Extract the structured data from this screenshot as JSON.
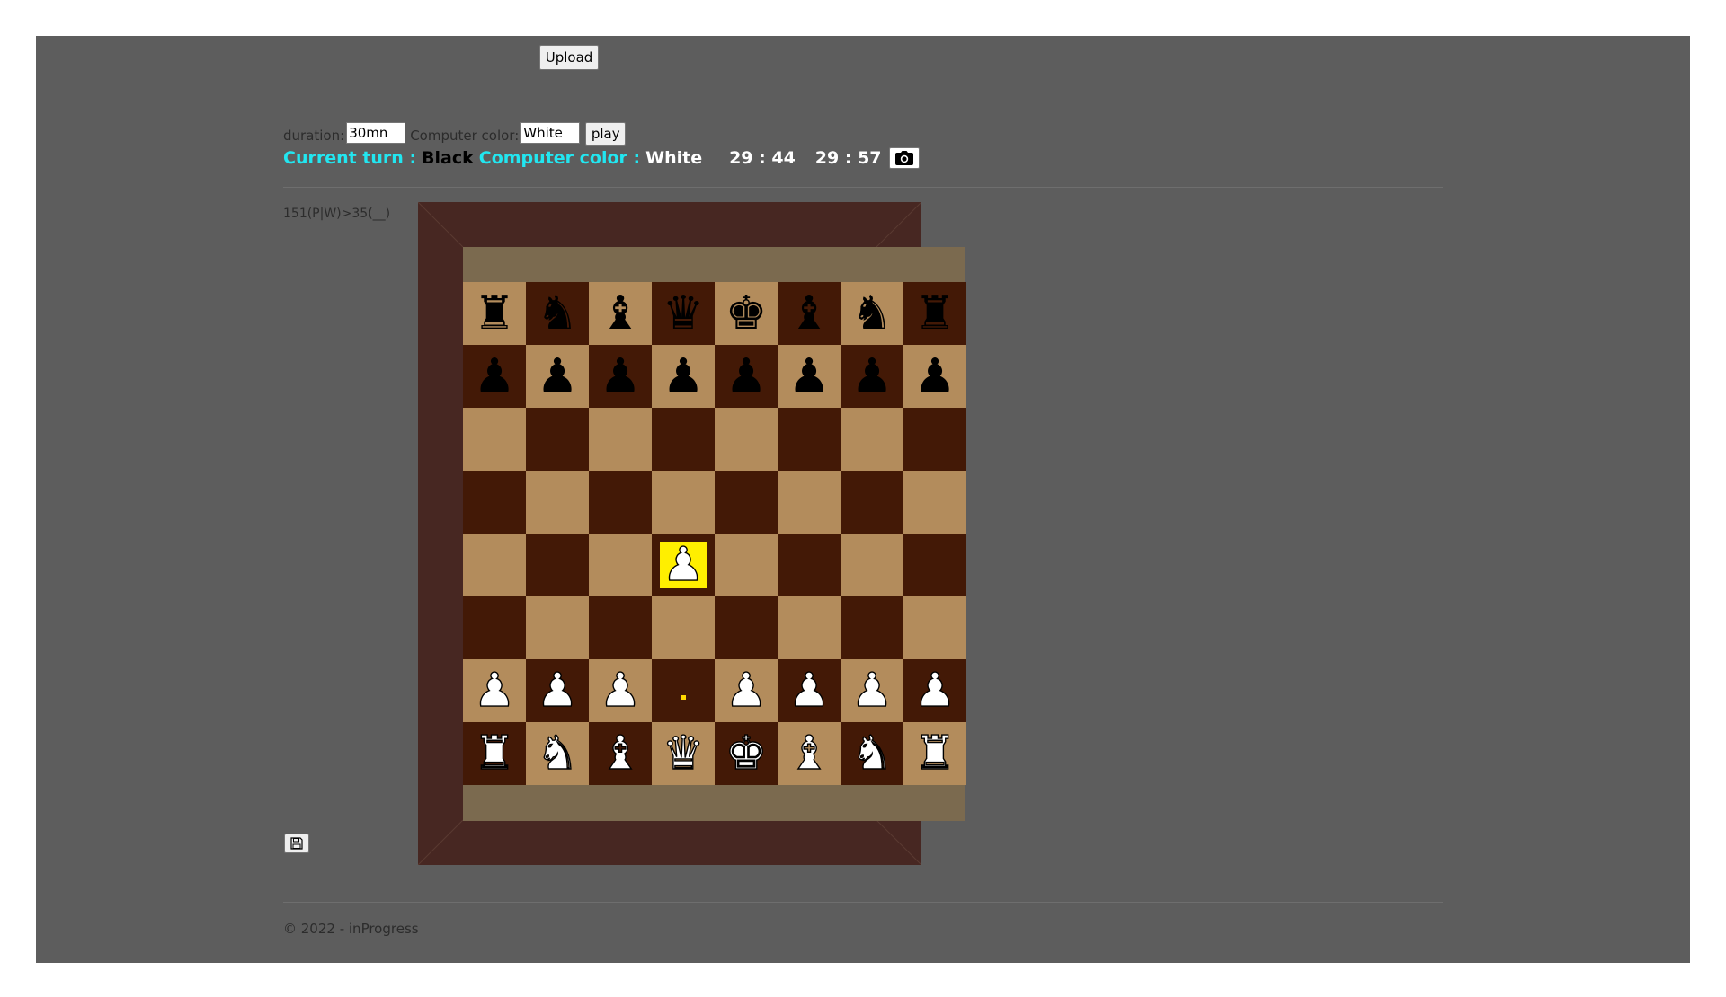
{
  "toolbar": {
    "upload_label": "Upload"
  },
  "settings": {
    "duration_label": "duration:",
    "duration_value": "30mn",
    "computer_color_label": "Computer color:",
    "computer_color_value": "White",
    "play_label": "play"
  },
  "status": {
    "current_turn_label": "Current turn :",
    "current_turn_value": "Black",
    "computer_color_label": "Computer color :",
    "computer_color_value": "White",
    "timer_1": "29 : 44",
    "timer_2": "29 : 57",
    "camera_icon": "camera-icon"
  },
  "move_notation": "151(P|W)>35(__)",
  "save_icon": "floppy-disk-icon",
  "footer": {
    "text": "© 2022 - inProgress"
  },
  "colors": {
    "light_square": "#b38c5c",
    "dark_square": "#431906",
    "frame": "#472722",
    "board_band": "#7b6a4f",
    "highlight": "#ffef00",
    "accent_text": "#22e6f0"
  },
  "board": {
    "ranks": [
      [
        "bR",
        "bN",
        "bB",
        "bQ",
        "bK",
        "bB",
        "bN",
        "bR"
      ],
      [
        "bP",
        "bP",
        "bP",
        "bP",
        "bP",
        "bP",
        "bP",
        "bP"
      ],
      [
        "",
        "",
        "",
        "",
        "",
        "",
        "",
        ""
      ],
      [
        "",
        "",
        "",
        "",
        "",
        "",
        "",
        ""
      ],
      [
        "",
        "",
        "",
        "wP",
        "",
        "",
        "",
        ""
      ],
      [
        "",
        "",
        "",
        "",
        "",
        "",
        "",
        ""
      ],
      [
        "wP",
        "wP",
        "wP",
        "",
        "wP",
        "wP",
        "wP",
        "wP"
      ],
      [
        "wR",
        "wN",
        "wB",
        "wQ",
        "wK",
        "wB",
        "wN",
        "wR"
      ]
    ],
    "highlighted_square": "d4",
    "marker_square": "d2"
  }
}
